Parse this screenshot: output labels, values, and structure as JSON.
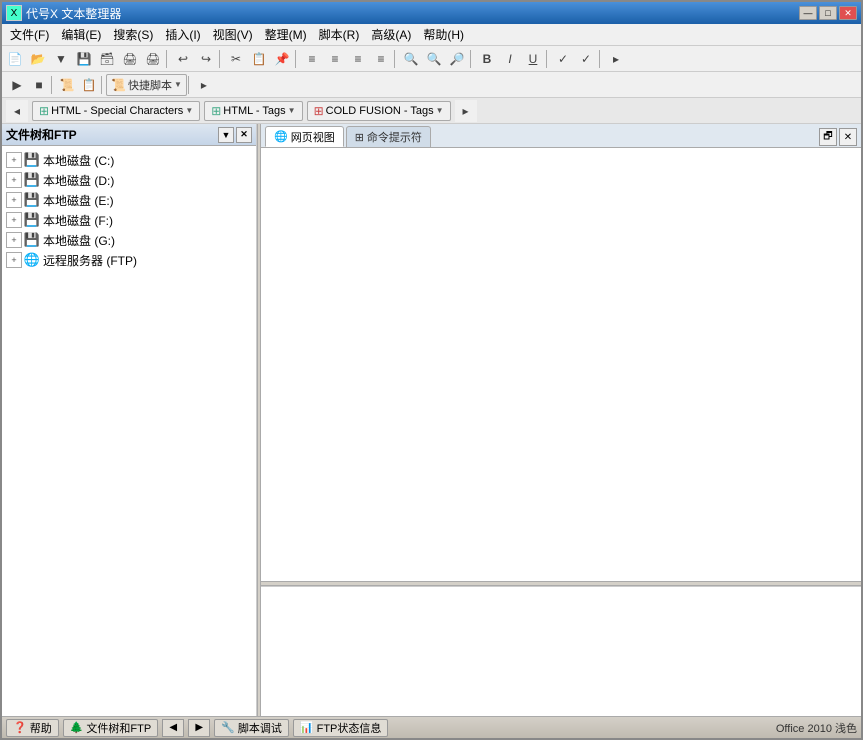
{
  "window": {
    "title": "代号X 文本整理器",
    "title_icon": "X"
  },
  "title_buttons": {
    "minimize": "—",
    "maximize": "□",
    "close": "✕"
  },
  "menu": {
    "items": [
      {
        "label": "文件(F)"
      },
      {
        "label": "编辑(E)"
      },
      {
        "label": "搜索(S)"
      },
      {
        "label": "插入(I)"
      },
      {
        "label": "视图(V)"
      },
      {
        "label": "整理(M)"
      },
      {
        "label": "脚本(R)"
      },
      {
        "label": "高级(A)"
      },
      {
        "label": "帮助(H)"
      }
    ]
  },
  "toolbar3": {
    "btn1_label": "HTML - Special Characters",
    "btn2_label": "HTML - Tags",
    "btn3_label": "COLD FUSION - Tags"
  },
  "toolbar2": {
    "quickscript_label": "快捷脚本"
  },
  "sidebar": {
    "title": "文件树和FTP",
    "dropdown_icon": "▼",
    "close_icon": "✕",
    "items": [
      {
        "label": "本地磁盘 (C:)",
        "type": "drive"
      },
      {
        "label": "本地磁盘 (D:)",
        "type": "drive"
      },
      {
        "label": "本地磁盘 (E:)",
        "type": "drive"
      },
      {
        "label": "本地磁盘 (F:)",
        "type": "drive"
      },
      {
        "label": "本地磁盘 (G:)",
        "type": "drive"
      },
      {
        "label": "远程服务器 (FTP)",
        "type": "ftp"
      }
    ]
  },
  "tabs": [
    {
      "label": "网页视图",
      "icon": "🌐",
      "active": true
    },
    {
      "label": "命令提示符",
      "icon": "⊞",
      "active": false
    }
  ],
  "tab_end_buttons": {
    "restore": "🗗",
    "close": "✕"
  },
  "resize_dots": ".........",
  "status_bar": {
    "nav_back": "◀",
    "nav_forward": "▶",
    "tabs": [
      {
        "label": "帮助",
        "icon": "help"
      },
      {
        "label": "文件树和FTP",
        "icon": "tree"
      },
      {
        "label": "脚本调试",
        "icon": "debug"
      },
      {
        "label": "FTP状态信息",
        "icon": "status"
      }
    ],
    "right_text": "Office 2010 浅色"
  }
}
